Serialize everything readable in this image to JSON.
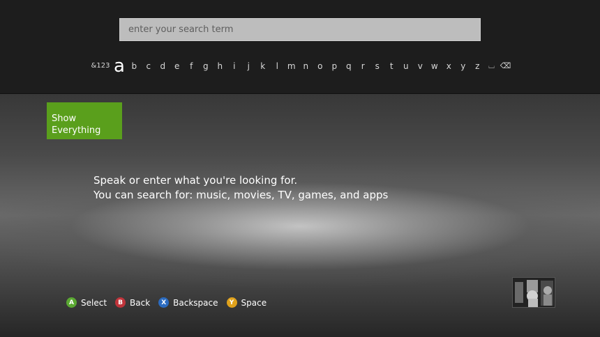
{
  "search": {
    "placeholder": "enter your search term",
    "value": ""
  },
  "keyboard": {
    "symbols_key": "&123",
    "selected_key": "a",
    "letters": [
      "b",
      "c",
      "d",
      "e",
      "f",
      "g",
      "h",
      "i",
      "j",
      "k",
      "l",
      "m",
      "n",
      "o",
      "p",
      "q",
      "r",
      "s",
      "t",
      "u",
      "v",
      "w",
      "x",
      "y",
      "z"
    ],
    "space_key": "⌴",
    "backspace_key": "⌫"
  },
  "filter": {
    "line1": "Show",
    "line2": "Everything",
    "accent_color": "#5a9f1c"
  },
  "hint": {
    "line1": "Speak or enter what you're looking for.",
    "line2": "You can search for: music, movies, TV, games, and apps"
  },
  "controls": [
    {
      "button": "A",
      "label": "Select",
      "color": "#5aa832"
    },
    {
      "button": "B",
      "label": "Back",
      "color": "#c0343b"
    },
    {
      "button": "X",
      "label": "Backspace",
      "color": "#2b6bc0"
    },
    {
      "button": "Y",
      "label": "Space",
      "color": "#e0a21c"
    }
  ],
  "profile": {
    "icon": "gamer-picture"
  }
}
